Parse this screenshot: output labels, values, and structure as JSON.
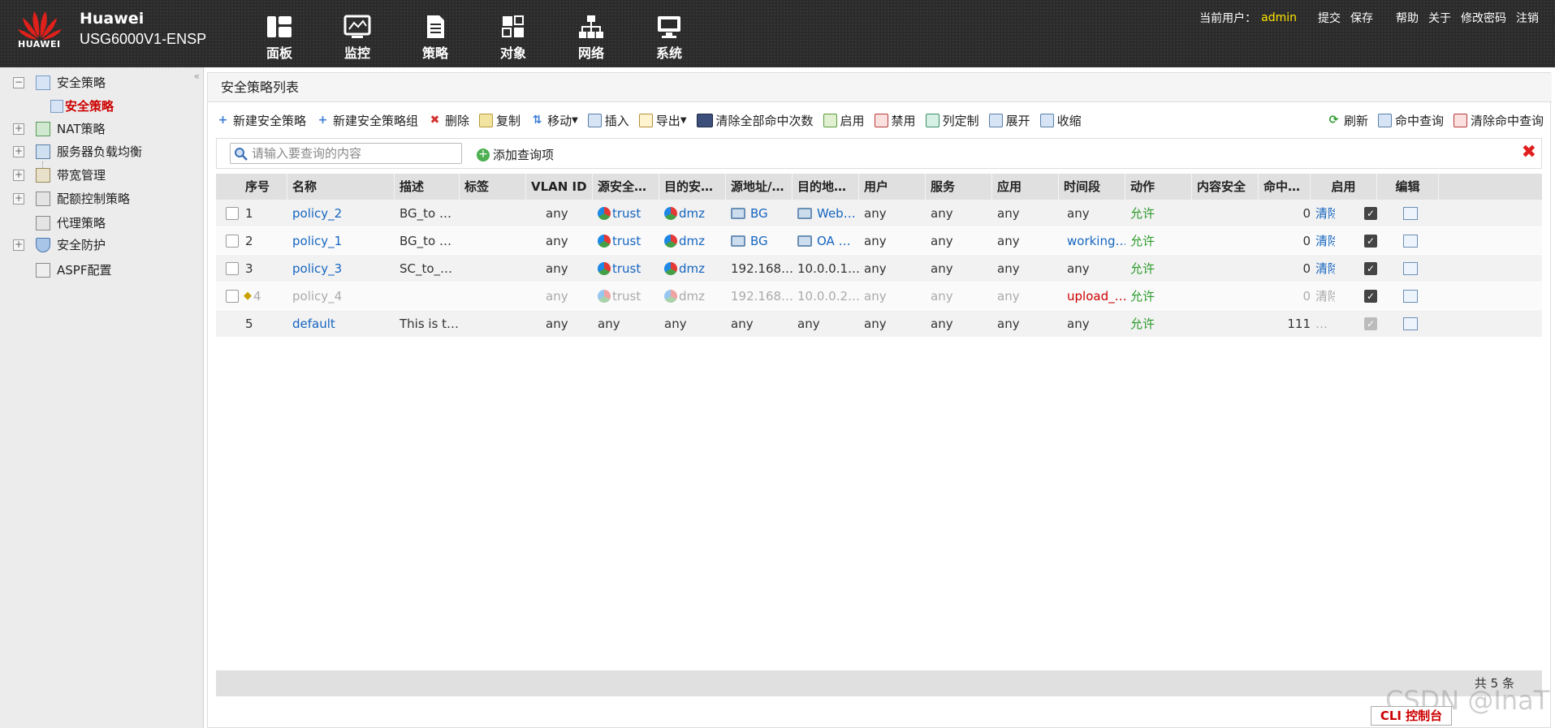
{
  "header": {
    "brand": "Huawei",
    "model": "USG6000V1-ENSP",
    "logo_text": "HUAWEI",
    "nav": [
      {
        "label": "面板",
        "icon": "dashboard-icon"
      },
      {
        "label": "监控",
        "icon": "monitor-icon"
      },
      {
        "label": "策略",
        "icon": "policy-icon"
      },
      {
        "label": "对象",
        "icon": "objects-icon"
      },
      {
        "label": "网络",
        "icon": "network-icon"
      },
      {
        "label": "系统",
        "icon": "system-icon"
      }
    ],
    "current_user_label": "当前用户：",
    "current_user": "admin",
    "links": [
      "提交",
      "保存",
      "帮助",
      "关于",
      "修改密码",
      "注销"
    ]
  },
  "sidebar": {
    "collapse": "«",
    "items": [
      {
        "label": "安全策略",
        "toggle": "−"
      },
      {
        "label": "安全策略",
        "active": true
      },
      {
        "label": "NAT策略",
        "toggle": "+"
      },
      {
        "label": "服务器负载均衡",
        "toggle": "+"
      },
      {
        "label": "带宽管理",
        "toggle": "+"
      },
      {
        "label": "配额控制策略",
        "toggle": "+"
      },
      {
        "label": "代理策略"
      },
      {
        "label": "安全防护",
        "toggle": "+"
      },
      {
        "label": "ASPF配置"
      }
    ]
  },
  "main": {
    "title": "安全策略列表",
    "toolbar": [
      "新建安全策略",
      "新建安全策略组",
      "删除",
      "复制",
      "移动",
      "插入",
      "导出",
      "清除全部命中次数",
      "启用",
      "禁用",
      "列定制",
      "展开",
      "收缩"
    ],
    "toolbar_right": [
      "刷新",
      "命中查询",
      "清除命中查询"
    ],
    "search_placeholder": "请输入要查询的内容",
    "add_query": "添加查询项",
    "close": "✖",
    "columns": [
      "序号",
      "名称",
      "描述",
      "标签",
      "VLAN ID",
      "源安全…",
      "目的安…",
      "源地址/…",
      "目的地…",
      "用户",
      "服务",
      "应用",
      "时间段",
      "动作",
      "内容安全",
      "命中…",
      "启用",
      "编辑"
    ],
    "rows": [
      {
        "no": "1",
        "name": "policy_2",
        "desc": "BG_to …",
        "tag": "",
        "vlan": "any",
        "src_zone": "trust",
        "dst_zone": "dmz",
        "src_addr": "BG",
        "dst_addr": "Web…",
        "user": "any",
        "service": "any",
        "app": "any",
        "time": "any",
        "action": "允许",
        "content": "",
        "hits": "0",
        "clear": "清除"
      },
      {
        "no": "2",
        "name": "policy_1",
        "desc": "BG_to …",
        "tag": "",
        "vlan": "any",
        "src_zone": "trust",
        "dst_zone": "dmz",
        "src_addr": "BG",
        "dst_addr": "OA …",
        "user": "any",
        "service": "any",
        "app": "any",
        "time": "working…",
        "action": "允许",
        "content": "",
        "hits": "0",
        "clear": "清除"
      },
      {
        "no": "3",
        "name": "policy_3",
        "desc": "SC_to_…",
        "tag": "",
        "vlan": "any",
        "src_zone": "trust",
        "dst_zone": "dmz",
        "src_addr": "192.168…",
        "dst_addr": "10.0.0.1…",
        "user": "any",
        "service": "any",
        "app": "any",
        "time": "any",
        "action": "允许",
        "content": "",
        "hits": "0",
        "clear": "清除"
      },
      {
        "no": "4",
        "name": "policy_4",
        "desc": "",
        "tag": "",
        "vlan": "any",
        "src_zone": "trust",
        "dst_zone": "dmz",
        "src_addr": "192.168…",
        "dst_addr": "10.0.0.2…",
        "user": "any",
        "service": "any",
        "app": "any",
        "time": "upload_…",
        "action": "允许",
        "content": "",
        "hits": "0",
        "clear": "清除"
      },
      {
        "no": "5",
        "name": "default",
        "desc": "This is t…",
        "tag": "",
        "vlan": "any",
        "src_zone": "any",
        "dst_zone": "any",
        "src_addr": "any",
        "dst_addr": "any",
        "user": "any",
        "service": "any",
        "app": "any",
        "time": "any",
        "action": "允许",
        "content": "",
        "hits": "111",
        "clear": "…"
      }
    ],
    "footer": "共 5 条"
  },
  "cli": "CLI 控制台",
  "watermark": "CSDN @InaT"
}
